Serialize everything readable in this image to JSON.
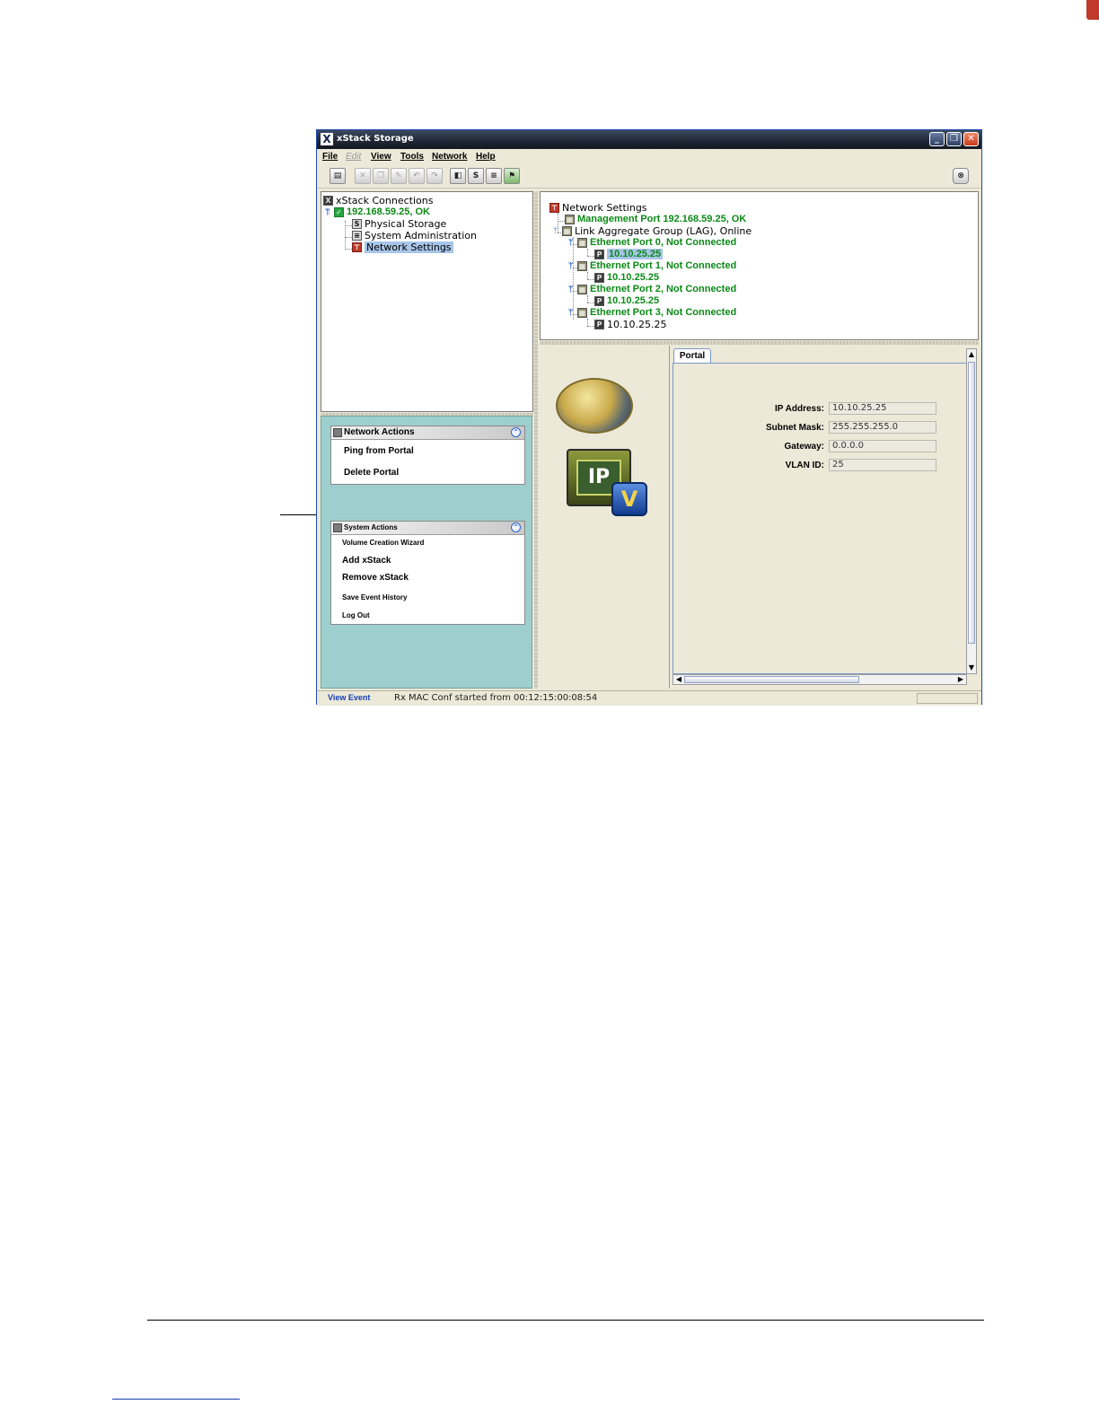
{
  "window": {
    "title": "xStack Storage",
    "app_icon": "X",
    "controls": {
      "minimize": "_",
      "restore": "❐",
      "close": "✕"
    }
  },
  "menu": {
    "items": [
      "File",
      "Edit",
      "View",
      "Tools",
      "Network",
      "Help"
    ],
    "disabled": [
      "Edit"
    ]
  },
  "toolbar": {
    "icons": [
      "properties-icon",
      "delete-icon",
      "copy-icon",
      "edit-icon",
      "undo-icon",
      "redo-icon",
      "network-icon",
      "storage-icon",
      "server-icon",
      "settings-icon",
      "stop-icon"
    ]
  },
  "connections_tree": {
    "root": "xStack Connections",
    "host": "192.168.59.25, OK",
    "children": [
      "Physical Storage",
      "System Administration",
      "Network Settings"
    ],
    "selected": "Network Settings"
  },
  "network_tree": {
    "root": "Network Settings",
    "management": "Management Port 192.168.59.25, OK",
    "lag": "Link Aggregate Group (LAG), Online",
    "ports": [
      {
        "label": "Ethernet Port 0, Not Connected",
        "ip": "10.10.25.25"
      },
      {
        "label": "Ethernet Port 1, Not Connected",
        "ip": "10.10.25.25"
      },
      {
        "label": "Ethernet Port 2, Not Connected",
        "ip": "10.10.25.25"
      },
      {
        "label": "Ethernet Port 3, Not Connected",
        "ip": "10.10.25.25"
      }
    ],
    "selected_ip": "10.10.25.25"
  },
  "network_actions": {
    "title": "Network Actions",
    "items": [
      "Ping from Portal",
      "Delete Portal"
    ]
  },
  "system_actions": {
    "title": "System Actions",
    "items": [
      "Volume Creation Wizard",
      "Add xStack",
      "Remove xStack",
      "Save Event History",
      "Log Out"
    ]
  },
  "detail": {
    "tab": "Portal",
    "icons": [
      "globe-network-icon",
      "ip-vlan-icon"
    ],
    "ip_badge": "IP",
    "vlan_badge": "V",
    "fields": [
      {
        "label": "IP Address:",
        "value": "10.10.25.25"
      },
      {
        "label": "Subnet Mask:",
        "value": "255.255.255.0"
      },
      {
        "label": "Gateway:",
        "value": "0.0.0.0"
      },
      {
        "label": "VLAN ID:",
        "value": "25"
      }
    ]
  },
  "statusbar": {
    "view_event": "View Event",
    "message": "Rx MAC Conf started from 00:12:15:00:08:54"
  },
  "colors": {
    "status_ok_green": "#0b8a16",
    "selection_blue": "#a7c5e8",
    "actions_panel_teal": "#9ecfcf",
    "link_blue": "#1440b4"
  }
}
